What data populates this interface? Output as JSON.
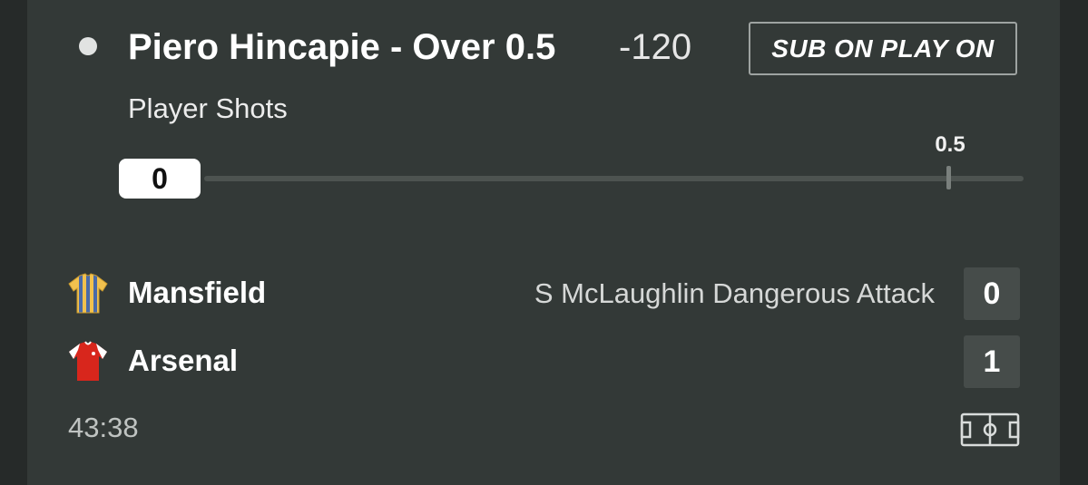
{
  "bet": {
    "selection": "Piero Hincapie - Over 0.5",
    "odds": "-120",
    "market": "Player Shots",
    "sub_button_label": "SUB ON PLAY ON"
  },
  "progress": {
    "current": "0",
    "threshold_label": "0.5",
    "current_value": 0,
    "threshold_value": 0.5
  },
  "match": {
    "home": {
      "name": "Mansfield",
      "score": "0",
      "kit_icon": "striped-shirt-icon",
      "kit_colors": [
        "#f2c14e",
        "#3a5a9c"
      ]
    },
    "away": {
      "name": "Arsenal",
      "score": "1",
      "kit_icon": "red-shirt-icon",
      "kit_colors": [
        "#d8261c",
        "#ffffff"
      ]
    },
    "commentary": "S McLaughlin Dangerous Attack",
    "clock": "43:38",
    "pitch_icon": "pitch-icon"
  },
  "colors": {
    "background": "#262a29",
    "card": "#333937",
    "score_box": "#464c4a"
  }
}
